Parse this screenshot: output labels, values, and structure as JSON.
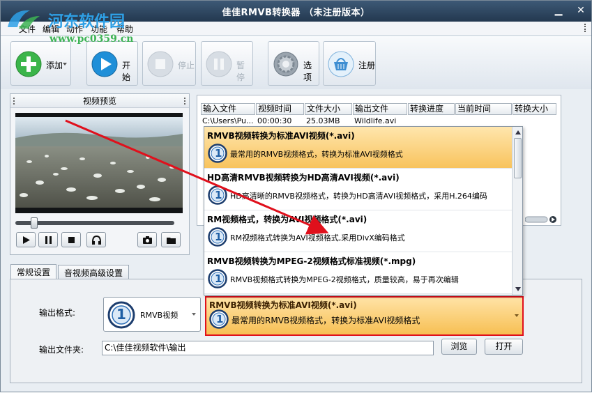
{
  "window": {
    "title": "佳佳RMVB转换器 （未注册版本）"
  },
  "watermark": {
    "text": "河东软件园",
    "url": "www.pc0359.cn"
  },
  "menu": {
    "items": [
      "文件",
      "编辑",
      "动作",
      "功能",
      "帮助"
    ]
  },
  "toolbar": {
    "add_label": "添加",
    "start_label": "开始",
    "stop_label": "停止",
    "pause_label": "暂停",
    "options_label": "选项",
    "register_label": "注册"
  },
  "preview": {
    "title": "视频预览"
  },
  "filelist": {
    "columns": [
      "输入文件",
      "视频时间",
      "文件大小",
      "输出文件",
      "转换进度",
      "当前时间",
      "转换大小"
    ],
    "rows": [
      {
        "input": "C:\\Users\\Pu...",
        "duration": "00:00:30",
        "size": "25.03MB",
        "output": "Wildlife.avi",
        "progress": "",
        "current": "",
        "converted": ""
      }
    ]
  },
  "dropdown": {
    "items": [
      {
        "num": "1",
        "title": "RMVB视频转换为标准AVI视频(*.avi)",
        "desc": "最常用的RMVB视频格式，转换为标准AVI视频格式"
      },
      {
        "num": "1",
        "title": "HD高清RMVB视频转换为HD高清AVI视频(*.avi)",
        "desc": "HD高清晰的RMVB视频格式，转换为HD高清AVI视频格式，采用H.264编码"
      },
      {
        "num": "1",
        "title": "RM视频格式，转换为AVI视频格式(*.avi)",
        "desc": "RM视频格式转换为AVI视频格式,采用DivX编码格式"
      },
      {
        "num": "1",
        "title": "RMVB视频转换为MPEG-2视频格式标准视频(*.mpg)",
        "desc": "RMVB视频格式转换为MPEG-2视频格式，质量较高，易于再次编辑"
      }
    ]
  },
  "tabs": {
    "general": "常规设置",
    "advanced": "音视频高级设置"
  },
  "settings": {
    "output_format_label": "输出格式:",
    "format_num": "1",
    "format_value": "RMVB视频",
    "selected_num": "1",
    "selected_title": "RMVB视频转换为标准AVI视频(*.avi)",
    "selected_desc": "最常用的RMVB视频格式，转换为标准AVI视频格式",
    "output_folder_label": "输出文件夹:",
    "output_folder_value": "C:\\佳佳视频软件\\输出",
    "browse_label": "浏览",
    "open_label": "打开"
  },
  "colors": {
    "highlight": "#f8c35d",
    "annotation_red": "#e0101c",
    "titlebar": "#2d4662"
  }
}
